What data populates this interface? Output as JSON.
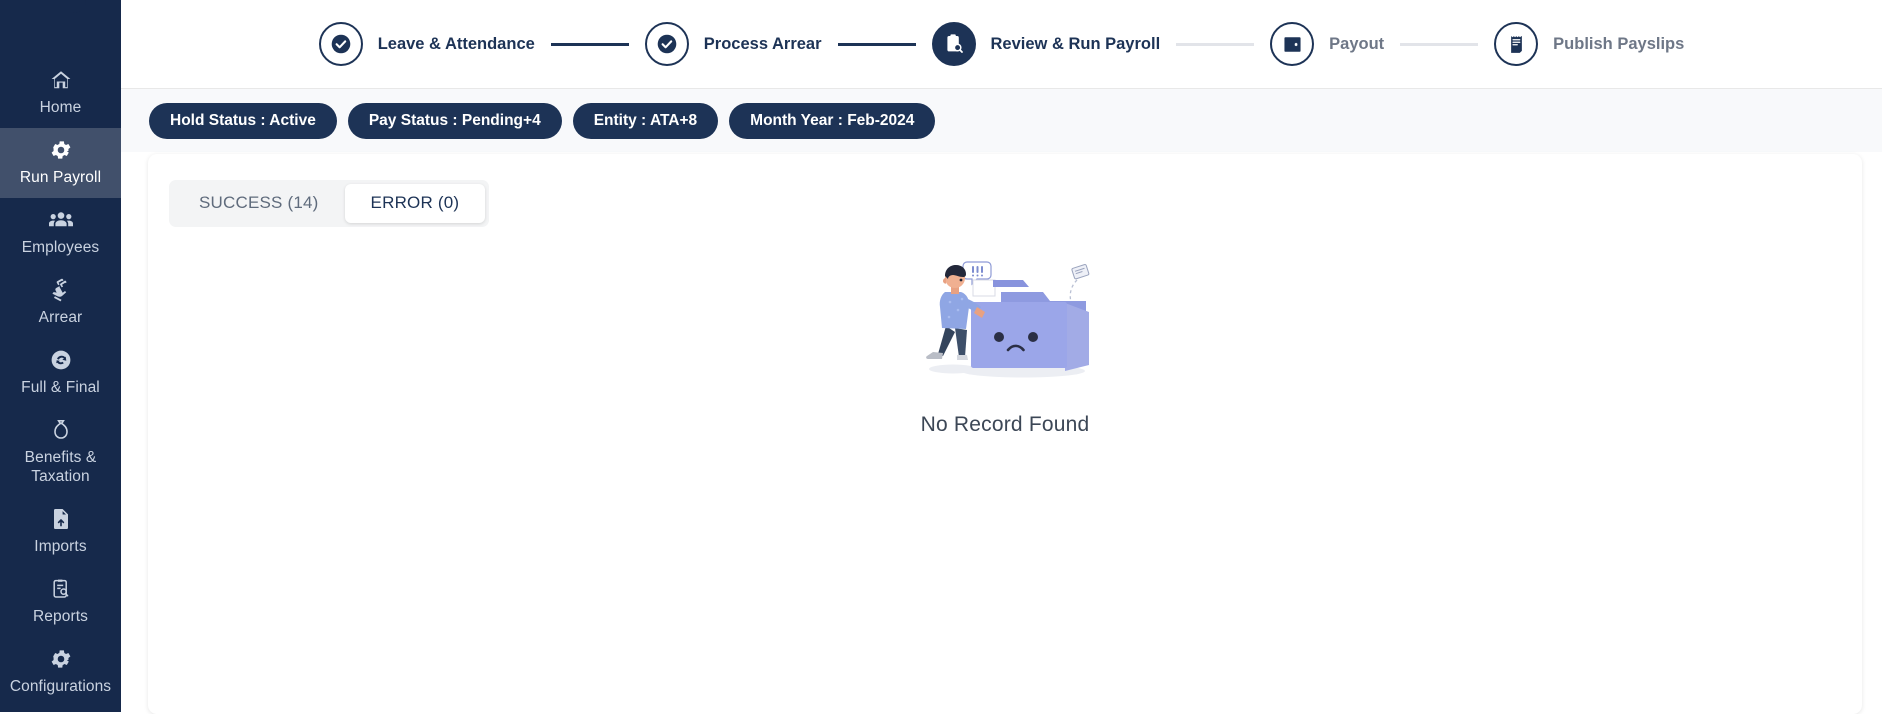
{
  "sidebar": {
    "items": [
      {
        "label": "Home",
        "icon": "home-icon",
        "active": false
      },
      {
        "label": "Run Payroll",
        "icon": "gear-icon",
        "active": true
      },
      {
        "label": "Employees",
        "icon": "people-icon",
        "active": false
      },
      {
        "label": "Arrear",
        "icon": "hand-cards-icon",
        "active": false
      },
      {
        "label": "Full & Final",
        "icon": "refresh-circle-icon",
        "active": false
      },
      {
        "label": "Benefits & Taxation",
        "icon": "money-bag-icon",
        "active": false
      },
      {
        "label": "Imports",
        "icon": "file-upload-icon",
        "active": false
      },
      {
        "label": "Reports",
        "icon": "report-search-icon",
        "active": false
      },
      {
        "label": "Configurations",
        "icon": "gear-icon",
        "active": false
      }
    ],
    "background_color": "#16294b",
    "active_color": "#41506b"
  },
  "stepper": {
    "steps": [
      {
        "label": "Leave & Attendance",
        "state": "done",
        "icon": "check-circle-icon"
      },
      {
        "label": "Process Arrear",
        "state": "done",
        "icon": "check-circle-icon"
      },
      {
        "label": "Review & Run Payroll",
        "state": "current",
        "icon": "clipboard-search-icon"
      },
      {
        "label": "Payout",
        "state": "todo",
        "icon": "wallet-icon"
      },
      {
        "label": "Publish Payslips",
        "state": "todo",
        "icon": "payslip-icon"
      }
    ],
    "accent_color": "#1d3356",
    "inactive_label_color": "#6e7787"
  },
  "filters": {
    "chips": [
      "Hold Status : Active",
      "Pay Status : Pending+4",
      "Entity : ATA+8",
      "Month Year : Feb-2024"
    ]
  },
  "card": {
    "tabs": [
      {
        "label": "SUCCESS (14)",
        "selected": false
      },
      {
        "label": "ERROR (0)",
        "selected": true
      }
    ],
    "empty_state": {
      "caption": "No Record Found",
      "illustration": "person-pushing-sad-folder-illustration"
    }
  }
}
